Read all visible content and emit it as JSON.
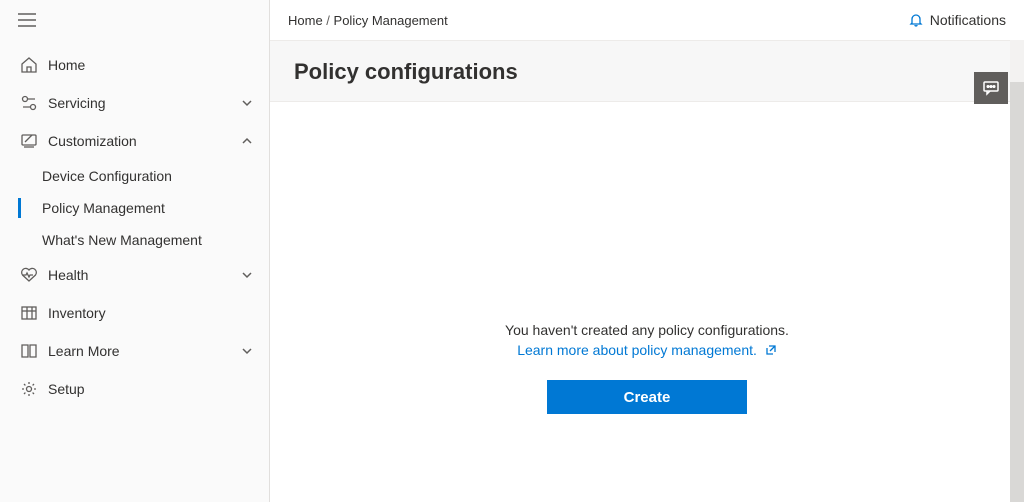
{
  "sidebar": {
    "home": "Home",
    "servicing": "Servicing",
    "customization": "Customization",
    "health": "Health",
    "inventory": "Inventory",
    "learn_more": "Learn More",
    "setup": "Setup",
    "custom_children": {
      "device_config": "Device Configuration",
      "policy_mgmt": "Policy Management",
      "whats_new": "What's New Management"
    }
  },
  "breadcrumb": {
    "root": "Home",
    "sep": " / ",
    "current": "Policy Management"
  },
  "topbar": {
    "notifications": "Notifications"
  },
  "page": {
    "title": "Policy configurations"
  },
  "empty": {
    "message": "You haven't created any policy configurations.",
    "learn_link": "Learn more about policy management.",
    "create_button": "Create"
  }
}
